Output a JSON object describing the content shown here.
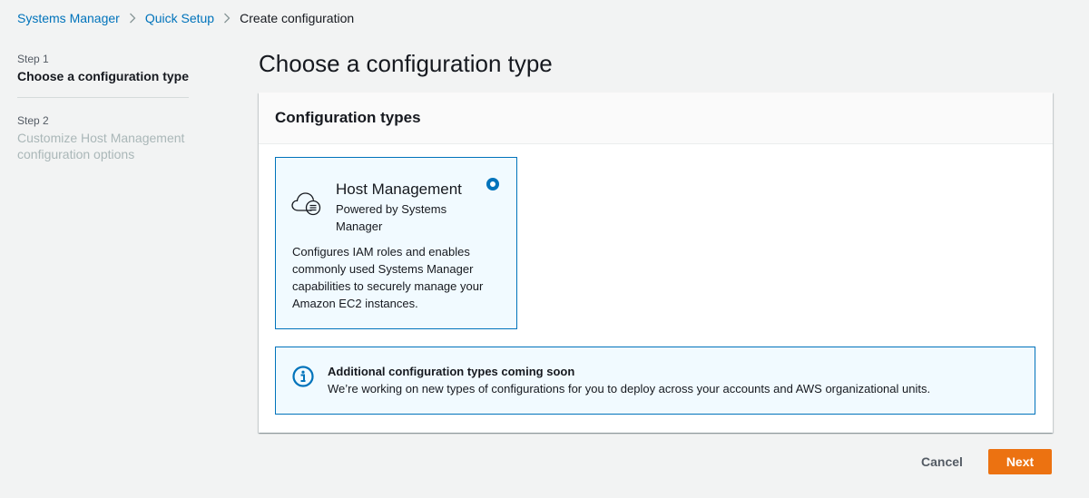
{
  "breadcrumb": {
    "items": [
      "Systems Manager",
      "Quick Setup"
    ],
    "current": "Create configuration"
  },
  "steps": [
    {
      "number": "Step 1",
      "title": "Choose a configuration type",
      "active": true
    },
    {
      "number": "Step 2",
      "title": "Customize Host Management configuration options",
      "active": false
    }
  ],
  "page": {
    "title": "Choose a configuration type"
  },
  "panel": {
    "title": "Configuration types",
    "tile": {
      "title": "Host Management",
      "subtitle": "Powered by Systems Manager",
      "description": "Configures IAM roles and enables commonly used Systems Manager capabilities to securely manage your Amazon EC2 instances.",
      "selected": true,
      "icon": "cloud-gear-icon"
    },
    "info": {
      "title": "Additional configuration types coming soon",
      "text": "We’re working on new types of configurations for you to deploy across your accounts and AWS organizational units.",
      "icon": "info-icon"
    }
  },
  "footer": {
    "cancel_label": "Cancel",
    "next_label": "Next"
  },
  "colors": {
    "link": "#0073bb",
    "primary_button": "#ec7211",
    "selected_border": "#0073bb",
    "selected_background": "#f1faff"
  }
}
